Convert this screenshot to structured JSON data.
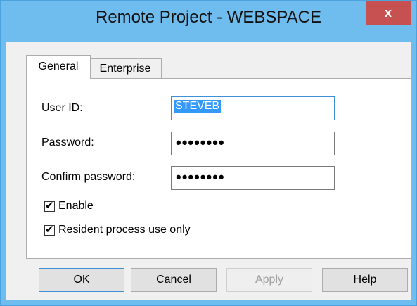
{
  "window": {
    "title": "Remote Project - WEBSPACE",
    "close_label": "x"
  },
  "tabs": [
    {
      "label": "General",
      "active": true
    },
    {
      "label": "Enterprise",
      "active": false
    }
  ],
  "form": {
    "user_id_label": "User ID:",
    "user_id_value": "STEVEB",
    "password_label": "Password:",
    "password_value": "••••••••",
    "confirm_label": "Confirm password:",
    "confirm_value": "••••••••",
    "enable_label": "Enable",
    "enable_checked": true,
    "resident_label": "Resident process use only",
    "resident_checked": true
  },
  "buttons": {
    "ok": "OK",
    "cancel": "Cancel",
    "apply": "Apply",
    "help": "Help"
  },
  "colors": {
    "accent": "#3399ff",
    "title_bar": "#6fbdee",
    "close_button": "#c75050"
  }
}
